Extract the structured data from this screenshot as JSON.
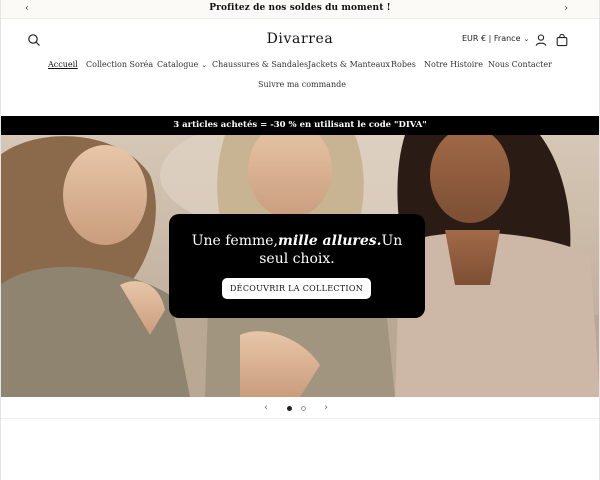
{
  "announcement": {
    "text": "Profitez de nos soldes du moment !"
  },
  "header": {
    "brand": "Divarrea",
    "locale": "EUR € | France"
  },
  "nav": {
    "items": [
      {
        "label": "Accueil"
      },
      {
        "label": "Collection Soréa"
      },
      {
        "label": "Catalogue"
      },
      {
        "label": "Chaussures & Sandales"
      },
      {
        "label": "Jackets & Manteaux"
      },
      {
        "label": "Robes"
      },
      {
        "label": "Notre Histoire"
      },
      {
        "label": "Nous Contacter"
      },
      {
        "label": "Suivre ma commande"
      }
    ]
  },
  "promo": {
    "text": "3 articles achetés = -30 % en utilisant le code \"DIVA\""
  },
  "hero": {
    "title_part1": "Une femme,",
    "title_emphasis": "mille allures.",
    "title_part2": "Un seul choix.",
    "cta_label": "DÉCOUVRIR LA COLLECTION"
  },
  "slider": {
    "current_slide": 1,
    "total_slides": 2
  },
  "icons": {
    "search": "search-icon",
    "account": "account-icon",
    "cart": "cart-icon",
    "prev": "chevron-left-icon",
    "next": "chevron-right-icon"
  }
}
